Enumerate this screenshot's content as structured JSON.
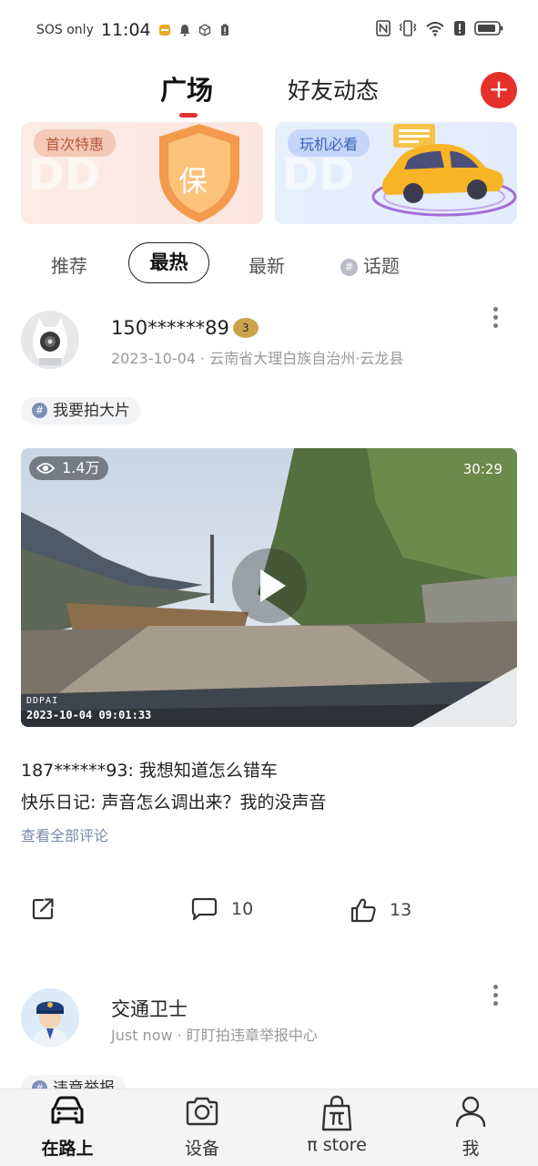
{
  "status_bar": {
    "carrier": "SOS only",
    "time": "11:04"
  },
  "header": {
    "tabs": [
      {
        "label": "广场",
        "active": true
      },
      {
        "label": "好友动态",
        "active": false
      }
    ],
    "add_icon": "plus-icon",
    "accent_color": "#e4312b"
  },
  "banners": [
    {
      "tag": "首次特惠",
      "emblem": "保"
    },
    {
      "tag": "玩机必看"
    }
  ],
  "sub_tabs": [
    {
      "label": "推荐",
      "active": false
    },
    {
      "label": "最热",
      "active": true
    },
    {
      "label": "最新",
      "active": false
    },
    {
      "label": "话题",
      "active": false,
      "icon": "hash-icon"
    }
  ],
  "posts": [
    {
      "username": "150******89",
      "level": "3",
      "date": "2023-10-04",
      "location": "云南省大理白族自治州·云龙县",
      "topic": "我要拍大片",
      "video": {
        "views": "1.4万",
        "duration": "30:29",
        "brand": "DDPAI",
        "timestamp": "2023-10-04 09:01:33"
      },
      "comments": [
        {
          "author": "187******93",
          "text": "我想知道怎么错车"
        },
        {
          "author": "快乐日记",
          "text": "声音怎么调出来？我的没声音"
        }
      ],
      "view_all_label": "查看全部评论",
      "actions": {
        "comment_count": "10",
        "like_count": "13"
      }
    },
    {
      "username": "交通卫士",
      "time": "Just now",
      "source": "盯盯拍违章举报中心",
      "topic": "违章举报"
    }
  ],
  "bottom_nav": [
    {
      "label": "在路上",
      "icon": "car-icon",
      "active": true
    },
    {
      "label": "设备",
      "icon": "camera-icon",
      "active": false
    },
    {
      "label": "π store",
      "icon": "shopping-bag-icon",
      "active": false
    },
    {
      "label": "我",
      "icon": "person-icon",
      "active": false
    }
  ]
}
